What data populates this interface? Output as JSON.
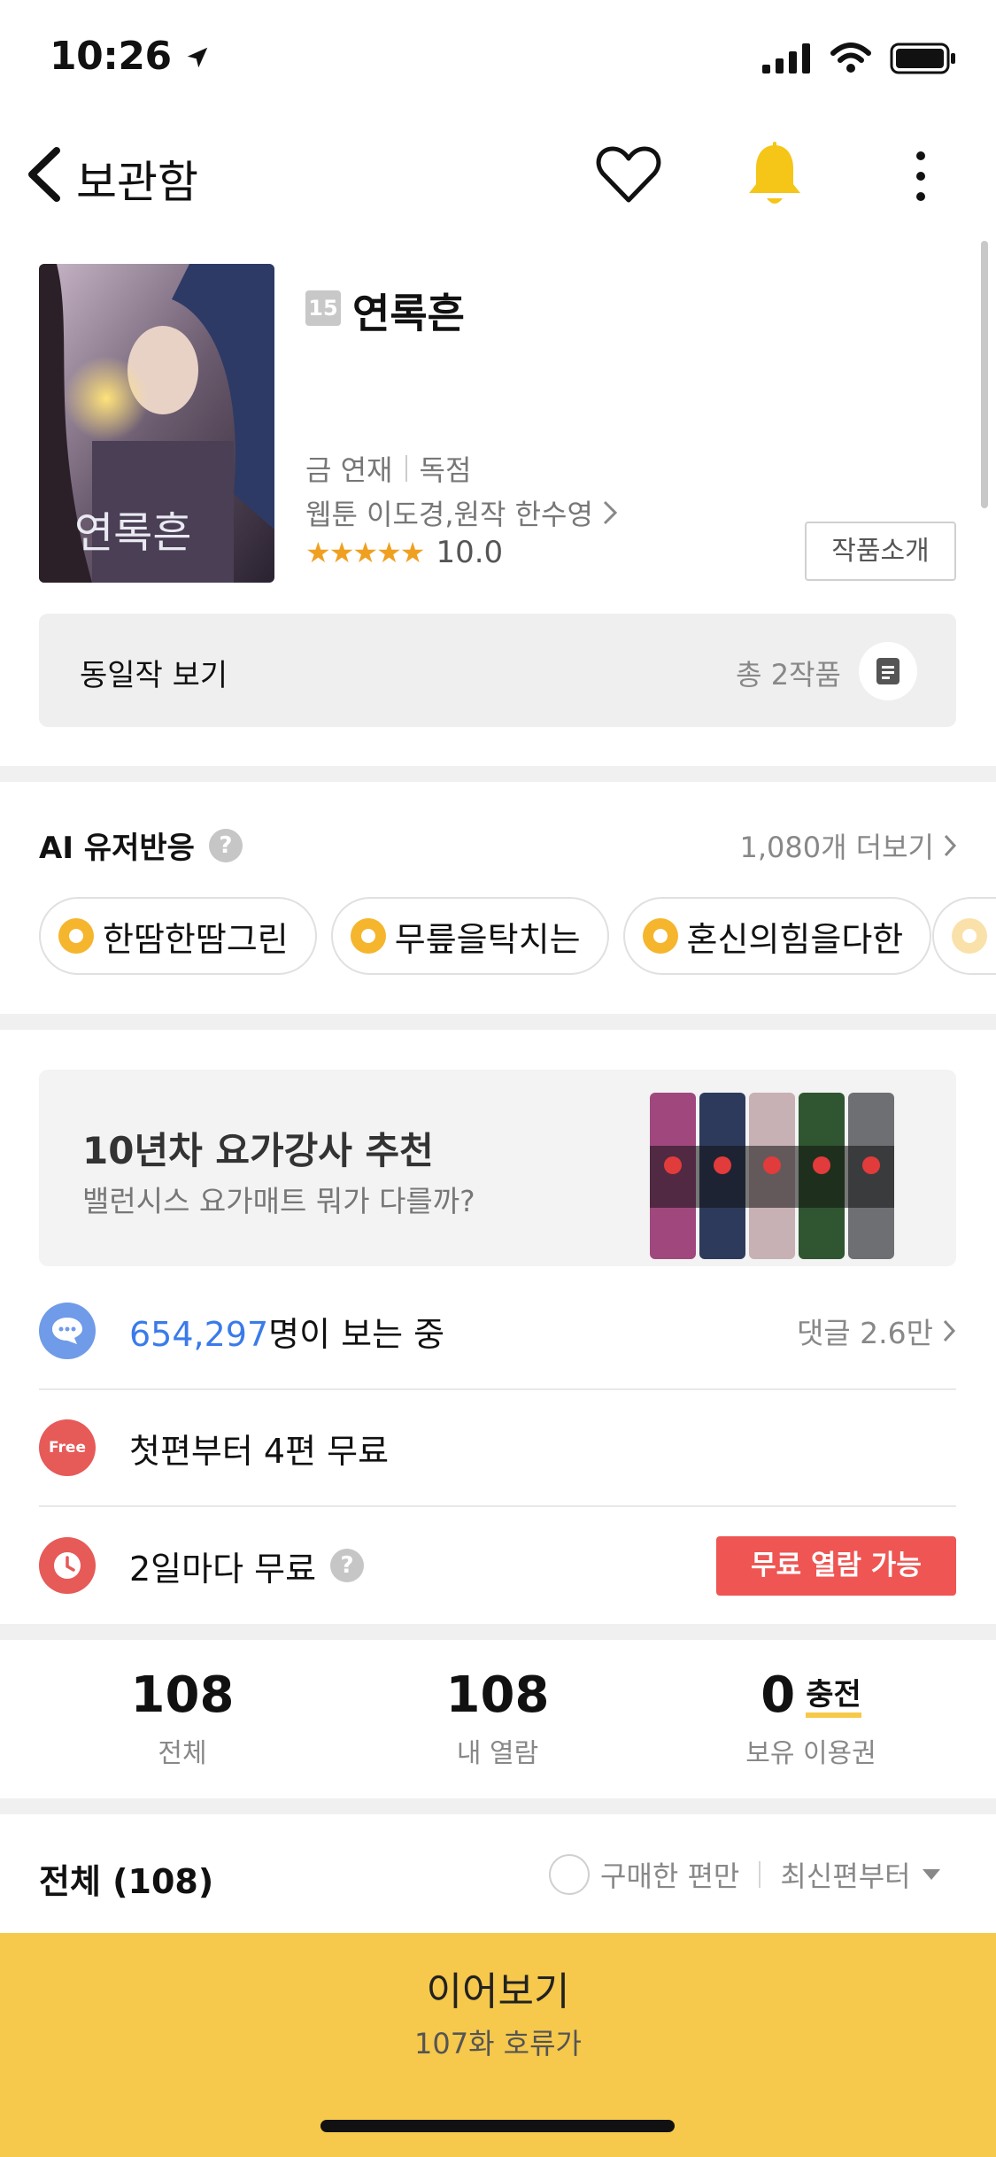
{
  "status": {
    "time": "10:26"
  },
  "nav": {
    "back_label": "보관함"
  },
  "comic": {
    "age": "15",
    "title": "연록흔",
    "schedule": "금 연재",
    "exclusive": "독점",
    "authors": "웹툰 이도경,원작 한수영",
    "stars": "★★★★★",
    "rating": "10.0",
    "intro_button": "작품소개",
    "cover_text": "연록흔"
  },
  "same_author": {
    "label": "동일작 보기",
    "count": "총 2작품"
  },
  "ai_reactions": {
    "title": "AI 유저반응",
    "help": "?",
    "more": "1,080개 더보기",
    "chips": [
      "한땀한땀그린",
      "무릎을탁치는",
      "혼신의힘을다한"
    ]
  },
  "ad": {
    "title": "10년차 요가강사 추천",
    "subtitle": "밸런시스 요가매트 뭐가 다를까?"
  },
  "info": {
    "viewers_num": "654,297",
    "viewers_suffix": "명이 보는 중",
    "comments": "댓글 2.6만",
    "free_badge": "Free",
    "free_text": "첫편부터 4편 무료",
    "wait_text": "2일마다 무료",
    "wait_help": "?",
    "wait_button": "무료 열람 가능"
  },
  "stats": {
    "total_num": "108",
    "total_label": "전체",
    "read_num": "108",
    "read_label": "내 열람",
    "ticket_num": "0",
    "charge_label": "충전",
    "ticket_label": "보유 이용권"
  },
  "list": {
    "title": "전체 (108)",
    "purchased_only": "구매한 편만",
    "sort": "최신편부터"
  },
  "cta": {
    "label": "이어보기",
    "sub": "107화 호류가"
  },
  "colors": {
    "accent_yellow": "#f6c84b",
    "free_red": "#ee5553",
    "link_blue": "#3a7bea",
    "bell_yellow": "#f5c518"
  }
}
